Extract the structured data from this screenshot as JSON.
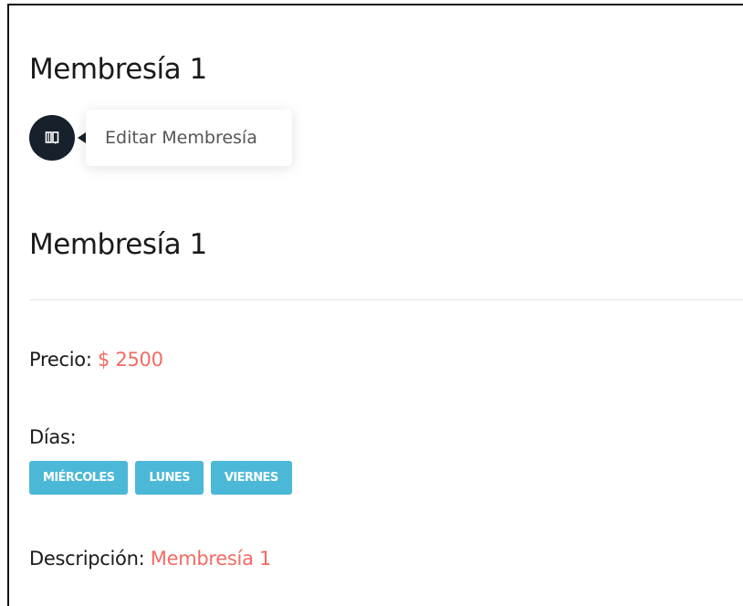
{
  "page": {
    "title": "Membresía 1"
  },
  "actions": {
    "edit_icon": "book-open-icon",
    "tooltip": "Editar Membresía"
  },
  "details": {
    "heading": "Membresía 1",
    "price_label": "Precio:",
    "price_value": "$ 2500",
    "days_label": "Días:",
    "days": [
      "MIÉRCOLES",
      "LUNES",
      "VIERNES"
    ],
    "description_label": "Descripción:",
    "description_value": "Membresía 1"
  },
  "colors": {
    "accent": "#f26b63",
    "badge": "#4cb8d8",
    "edit_button": "#17212b",
    "text": "#1a1a1a"
  }
}
